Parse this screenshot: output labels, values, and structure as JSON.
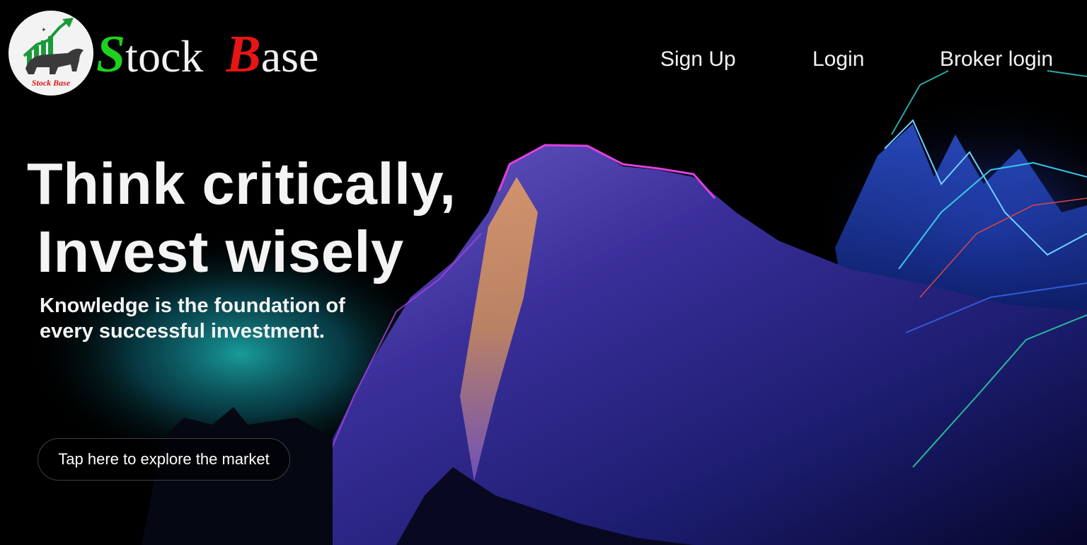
{
  "brand": {
    "badge_text": "Stock Base",
    "initial_1": "S",
    "rest_1": "tock",
    "initial_2": "B",
    "rest_2": "ase",
    "colors": {
      "s_green": "#1fd11f",
      "b_red": "#e81515"
    }
  },
  "nav": {
    "signup": "Sign Up",
    "login": "Login",
    "broker_login": "Broker login"
  },
  "hero": {
    "headline_line1": "Think critically,",
    "headline_line2": "Invest wisely",
    "subtext": "Knowledge is the foundation of every successful investment.",
    "cta_label": "Tap here to explore the market",
    "background": "neon mountain with stock chart lines"
  },
  "colors": {
    "background": "#000000",
    "text": "#f4f4f4"
  }
}
